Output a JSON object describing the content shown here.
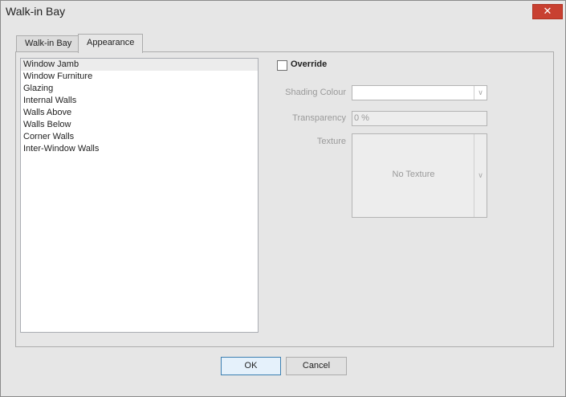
{
  "window": {
    "title": "Walk-in Bay",
    "close_glyph": "✕"
  },
  "tabs": [
    {
      "label": "Walk-in Bay",
      "active": false
    },
    {
      "label": "Appearance",
      "active": true
    }
  ],
  "list": {
    "items": [
      {
        "label": "Window Jamb",
        "selected": true
      },
      {
        "label": "Window Furniture"
      },
      {
        "label": "Glazing"
      },
      {
        "label": "Internal Walls"
      },
      {
        "label": "Walls Above"
      },
      {
        "label": "Walls Below"
      },
      {
        "label": "Corner Walls"
      },
      {
        "label": "Inter-Window Walls"
      }
    ]
  },
  "override": {
    "label": "Override",
    "checked": false
  },
  "fields": {
    "shading_colour_label": "Shading Colour",
    "shading_colour_value": "",
    "transparency_label": "Transparency",
    "transparency_value": "0 %",
    "texture_label": "Texture",
    "texture_value": "No Texture",
    "dropdown_glyph": "∨"
  },
  "buttons": {
    "ok_label": "OK",
    "cancel_label": "Cancel"
  },
  "colors": {
    "accent": "#3c7fb1",
    "close": "#c84031",
    "disabled_text": "#9a9a9a"
  }
}
